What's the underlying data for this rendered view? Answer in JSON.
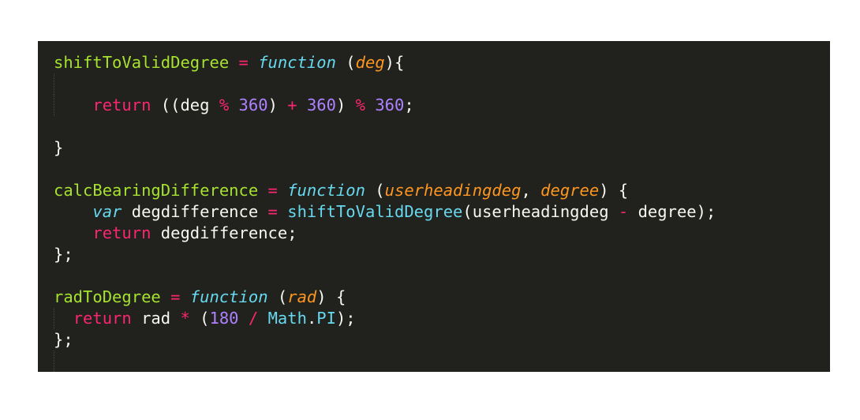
{
  "theme": {
    "background": "#21211d",
    "colors": {
      "name": "#a6e22e",
      "op": "#f92672",
      "kw": "#f92672",
      "fn": "#66d9ef",
      "param": "#fd971f",
      "num": "#ae81ff",
      "builtin": "#66d9ef",
      "plain": "#f8f8f2"
    }
  },
  "lines": [
    {
      "tokens": [
        [
          "name",
          "shiftToValidDegree"
        ],
        [
          "plain",
          " "
        ],
        [
          "op",
          "="
        ],
        [
          "plain",
          " "
        ],
        [
          "fn",
          "function"
        ],
        [
          "plain",
          " ("
        ],
        [
          "param",
          "deg"
        ],
        [
          "plain",
          "){"
        ]
      ]
    },
    {
      "guide": true,
      "tokens": []
    },
    {
      "guide": true,
      "tokens": [
        [
          "plain",
          "    "
        ],
        [
          "kw",
          "return"
        ],
        [
          "plain",
          " ((deg "
        ],
        [
          "op",
          "%"
        ],
        [
          "plain",
          " "
        ],
        [
          "num",
          "360"
        ],
        [
          "plain",
          ") "
        ],
        [
          "op",
          "+"
        ],
        [
          "plain",
          " "
        ],
        [
          "num",
          "360"
        ],
        [
          "plain",
          ") "
        ],
        [
          "op",
          "%"
        ],
        [
          "plain",
          " "
        ],
        [
          "num",
          "360"
        ],
        [
          "plain",
          ";"
        ]
      ]
    },
    {
      "tokens": []
    },
    {
      "tokens": [
        [
          "plain",
          "}"
        ]
      ]
    },
    {
      "tokens": []
    },
    {
      "tokens": [
        [
          "name",
          "calcBearingDifference"
        ],
        [
          "plain",
          " "
        ],
        [
          "op",
          "="
        ],
        [
          "plain",
          " "
        ],
        [
          "fn",
          "function"
        ],
        [
          "plain",
          " ("
        ],
        [
          "param",
          "userheadingdeg"
        ],
        [
          "plain",
          ", "
        ],
        [
          "param",
          "degree"
        ],
        [
          "plain",
          ") {"
        ]
      ]
    },
    {
      "tokens": [
        [
          "plain",
          "    "
        ],
        [
          "fn",
          "var"
        ],
        [
          "plain",
          " degdifference "
        ],
        [
          "op",
          "="
        ],
        [
          "plain",
          " "
        ],
        [
          "builtin",
          "shiftToValidDegree"
        ],
        [
          "plain",
          "(userheadingdeg "
        ],
        [
          "op",
          "-"
        ],
        [
          "plain",
          " degree);"
        ]
      ]
    },
    {
      "tokens": [
        [
          "plain",
          "    "
        ],
        [
          "kw",
          "return"
        ],
        [
          "plain",
          " degdifference;"
        ]
      ]
    },
    {
      "tokens": [
        [
          "plain",
          "};"
        ]
      ]
    },
    {
      "tokens": []
    },
    {
      "tokens": [
        [
          "name",
          "radToDegree"
        ],
        [
          "plain",
          " "
        ],
        [
          "op",
          "="
        ],
        [
          "plain",
          " "
        ],
        [
          "fn",
          "function"
        ],
        [
          "plain",
          " ("
        ],
        [
          "param",
          "rad"
        ],
        [
          "plain",
          ") {"
        ]
      ]
    },
    {
      "guide": true,
      "tokens": [
        [
          "plain",
          "  "
        ],
        [
          "kw",
          "return"
        ],
        [
          "plain",
          " rad "
        ],
        [
          "op",
          "*"
        ],
        [
          "plain",
          " ("
        ],
        [
          "num",
          "180"
        ],
        [
          "plain",
          " "
        ],
        [
          "op",
          "/"
        ],
        [
          "plain",
          " "
        ],
        [
          "builtin",
          "Math"
        ],
        [
          "plain",
          "."
        ],
        [
          "builtin",
          "PI"
        ],
        [
          "plain",
          ");"
        ]
      ]
    },
    {
      "tokens": [
        [
          "plain",
          "};"
        ]
      ]
    },
    {
      "guide": true,
      "tokens": []
    }
  ]
}
